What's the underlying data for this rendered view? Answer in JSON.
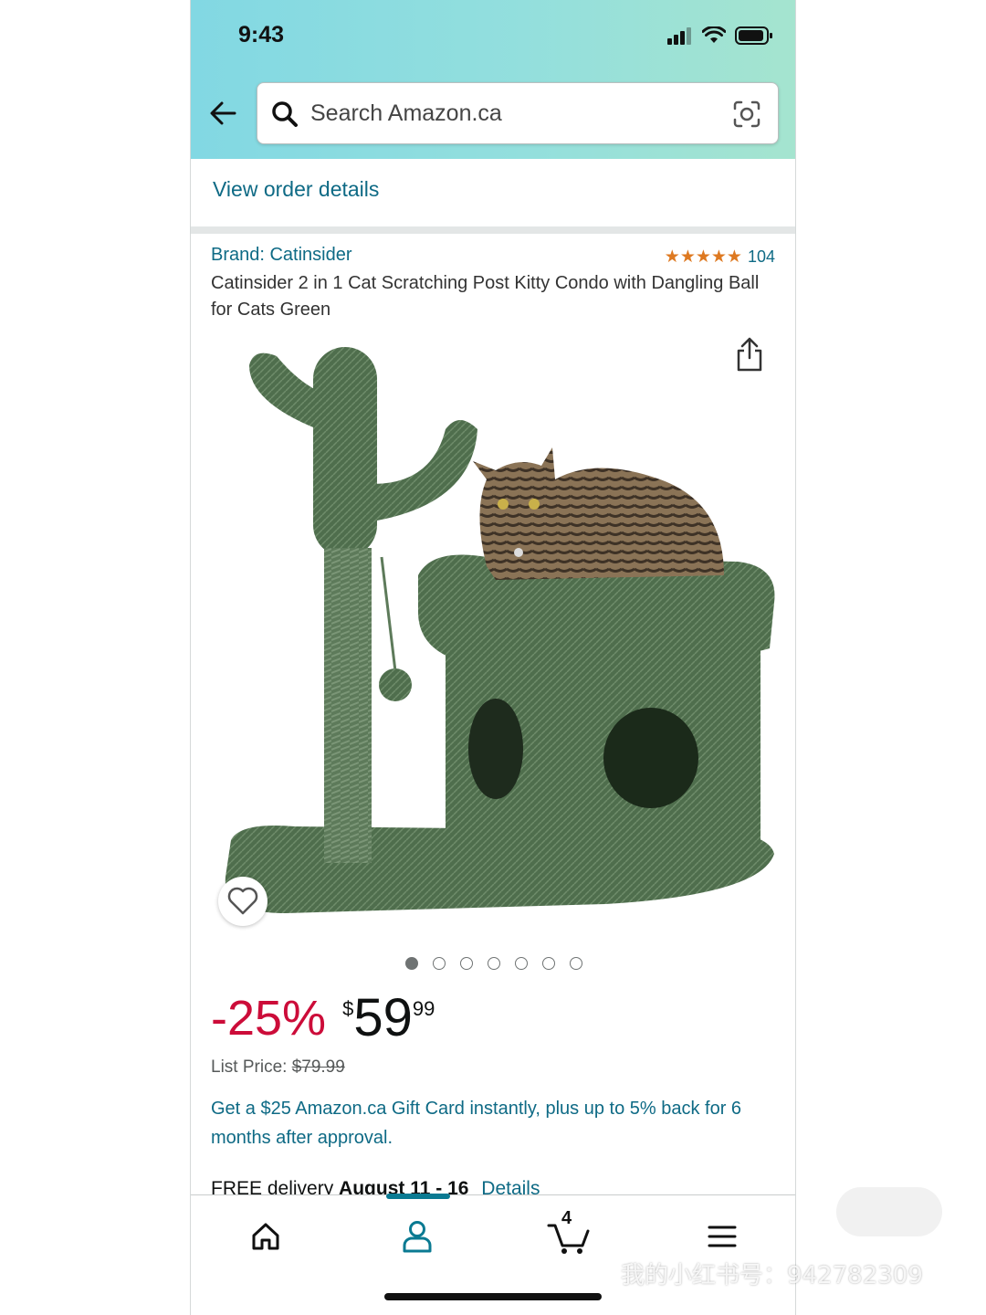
{
  "status_bar": {
    "time": "9:43"
  },
  "header": {
    "search_placeholder": "Search Amazon.ca"
  },
  "order": {
    "view_details": "View order details"
  },
  "product": {
    "brand": "Brand: Catinsider",
    "rating_stars": "★★★★★",
    "rating_value": 4.5,
    "rating_count": "104",
    "title": "Catinsider 2 in 1 Cat Scratching Post Kitty Condo with Dangling Ball for Cats Green",
    "image_count": 7,
    "active_image": 1
  },
  "pricing": {
    "discount": "-25%",
    "currency": "$",
    "price_whole": "59",
    "price_fraction": "99",
    "list_price_label": "List Price:",
    "list_price_value": "$79.99"
  },
  "promo": {
    "text": "Get a $25 Amazon.ca Gift Card instantly, plus up to 5% back for 6 months after approval."
  },
  "delivery": {
    "prefix": "FREE delivery",
    "dates": "August 11 - 16",
    "details_link": "Details"
  },
  "bottom_nav": {
    "items": [
      "home-icon",
      "account-icon",
      "cart-icon",
      "menu-icon"
    ],
    "cart_count": "4",
    "active": "account"
  },
  "watermark": {
    "text": "我的小红书号：942782309"
  },
  "colors": {
    "link": "#0e6a85",
    "discount": "#cc0c39",
    "star": "#de7921",
    "header_gradient_start": "#82d8e3",
    "header_gradient_end": "#a5e4cf"
  }
}
